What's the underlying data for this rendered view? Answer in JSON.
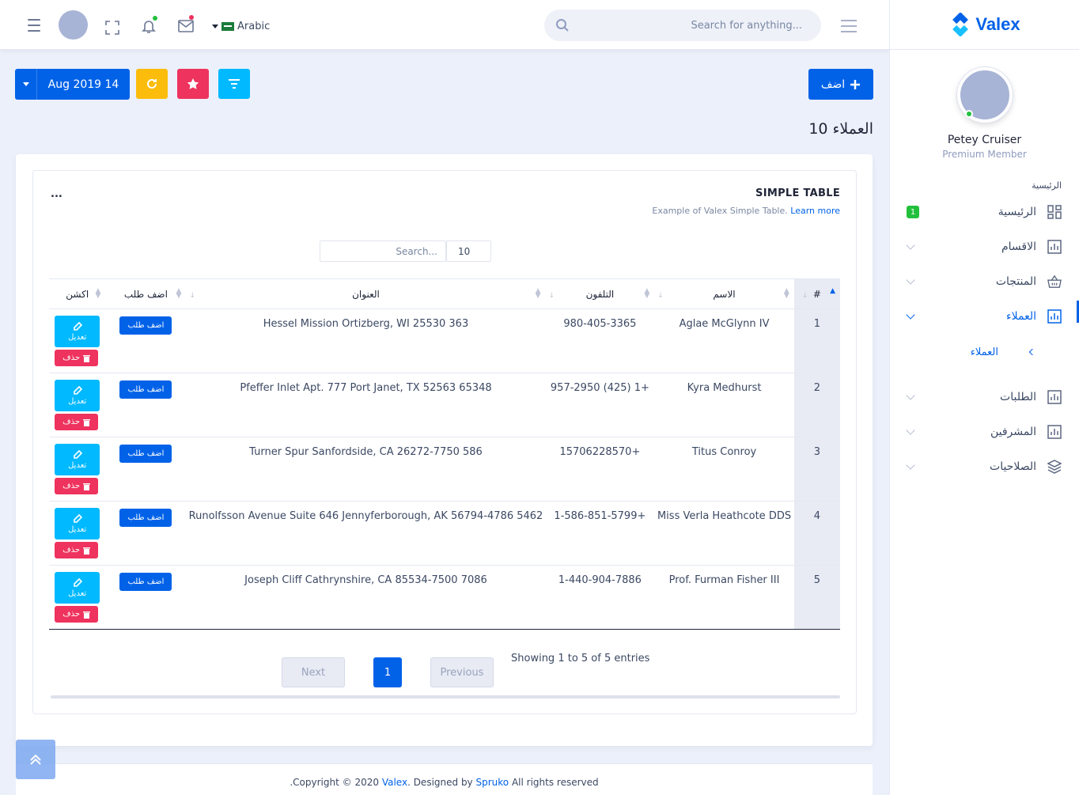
{
  "header": {
    "language": "Arabic",
    "search_placeholder": "Search for anything..."
  },
  "sidebar": {
    "brand": "Valex",
    "user_name": "Petey Cruiser",
    "user_role": "Premium Member",
    "category": "الرئيسية",
    "items": [
      {
        "label": "الرئيسية",
        "badge": "1"
      },
      {
        "label": "الاقسام"
      },
      {
        "label": "المنتجات"
      },
      {
        "label": "العملاء"
      },
      {
        "label": "الطلبات"
      },
      {
        "label": "المشرفين"
      },
      {
        "label": "الصلاحيات"
      }
    ],
    "sub_item": "العملاء"
  },
  "toolbar": {
    "date": "Aug 2019 14",
    "add_label": "اضف"
  },
  "page": {
    "title": "العملاء",
    "count": "10"
  },
  "card": {
    "dots": "...",
    "title": "SIMPLE TABLE",
    "subtitle": "Example of Valex Simple Table.",
    "learn_more": "Learn more",
    "search_placeholder": "Search...",
    "page_length": "10"
  },
  "table": {
    "headers": {
      "idx": "#",
      "name": "الاسم",
      "phone": "التلفون",
      "address": "العنوان",
      "order": "اضف طلب",
      "action": "اكشن"
    },
    "order_btn": "اضف طلب",
    "edit_btn": "تعديل",
    "delete_btn": "حذف",
    "rows": [
      {
        "idx": "1",
        "name": "Aglae McGlynn IV",
        "phone": "980-405-3365",
        "address": "Hessel Mission Ortizberg, WI 25530 363"
      },
      {
        "idx": "2",
        "name": "Kyra Medhurst",
        "phone": "957-2950 (425) 1+",
        "address": "Pfeffer Inlet Apt. 777 Port Janet, TX 52563 65348"
      },
      {
        "idx": "3",
        "name": "Titus Conroy",
        "phone": "15706228570+",
        "address": "Turner Spur Sanfordside, CA 26272-7750 586"
      },
      {
        "idx": "4",
        "name": "Miss Verla Heathcote DDS",
        "phone": "1-586-851-5799+",
        "address": "Runolfsson Avenue Suite 646 Jennyferborough, AK 56794-4786 5462"
      },
      {
        "idx": "5",
        "name": "Prof. Furman Fisher III",
        "phone": "1-440-904-7886",
        "address": "Joseph Cliff Cathrynshire, CA 85534-7500 7086"
      }
    ]
  },
  "pagination": {
    "info": "Showing 1 to 5 of 5 entries",
    "previous": "Previous",
    "page": "1",
    "next": "Next"
  },
  "footer": {
    "prefix": ".Copyright © 2020",
    "brand": "Valex",
    "designed": ". Designed by",
    "designer": "Spruko",
    "suffix": "All rights reserved"
  },
  "colors": {
    "primary": "#0162e8",
    "warning": "#fbbc0b",
    "danger": "#ee335e",
    "info": "#00b9ff",
    "success": "#22c03c"
  }
}
